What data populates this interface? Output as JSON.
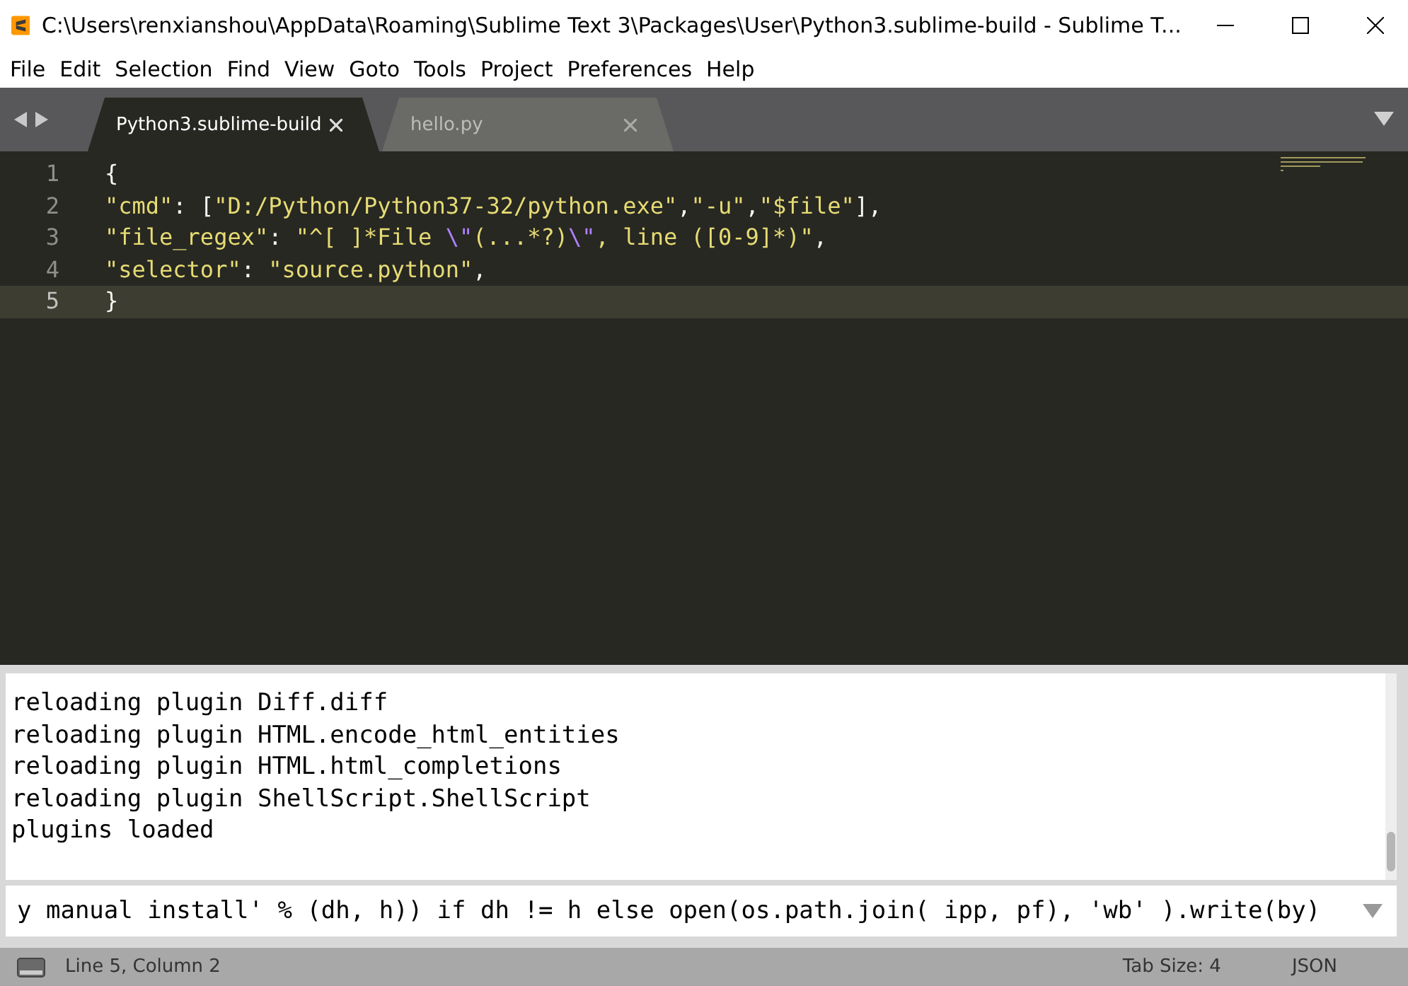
{
  "window": {
    "title": "C:\\Users\\renxianshou\\AppData\\Roaming\\Sublime Text 3\\Packages\\User\\Python3.sublime-build - Sublime T..."
  },
  "menu": [
    "File",
    "Edit",
    "Selection",
    "Find",
    "View",
    "Goto",
    "Tools",
    "Project",
    "Preferences",
    "Help"
  ],
  "tabs": [
    {
      "label": "Python3.sublime-build",
      "selected": true
    },
    {
      "label": "hello.py",
      "selected": false
    }
  ],
  "editor": {
    "lines": [
      {
        "number": "1",
        "current": false,
        "tokens": [
          {
            "kind": "plain",
            "text": "{"
          }
        ]
      },
      {
        "number": "2",
        "current": false,
        "tokens": [
          {
            "kind": "string",
            "text": "\"cmd\""
          },
          {
            "kind": "plain",
            "text": ": ["
          },
          {
            "kind": "string",
            "text": "\"D:/Python/Python37-32/python.exe\""
          },
          {
            "kind": "plain",
            "text": ","
          },
          {
            "kind": "string",
            "text": "\"-u\""
          },
          {
            "kind": "plain",
            "text": ","
          },
          {
            "kind": "string",
            "text": "\"$file\""
          },
          {
            "kind": "plain",
            "text": "],"
          }
        ]
      },
      {
        "number": "3",
        "current": false,
        "tokens": [
          {
            "kind": "string",
            "text": "\"file_regex\""
          },
          {
            "kind": "plain",
            "text": ": "
          },
          {
            "kind": "string",
            "text": "\"^[ ]*File "
          },
          {
            "kind": "escape",
            "text": "\\\""
          },
          {
            "kind": "string",
            "text": "(...*?)"
          },
          {
            "kind": "escape",
            "text": "\\\""
          },
          {
            "kind": "string",
            "text": ", line ([0-9]*)\""
          },
          {
            "kind": "plain",
            "text": ","
          }
        ]
      },
      {
        "number": "4",
        "current": false,
        "tokens": [
          {
            "kind": "string",
            "text": "\"selector\""
          },
          {
            "kind": "plain",
            "text": ": "
          },
          {
            "kind": "string",
            "text": "\"source.python\""
          },
          {
            "kind": "plain",
            "text": ","
          }
        ]
      },
      {
        "number": "5",
        "current": true,
        "tokens": [
          {
            "kind": "plain",
            "text": "}"
          }
        ]
      }
    ]
  },
  "console": {
    "lines": [
      "reloading plugin Diff.diff",
      "reloading plugin HTML.encode_html_entities",
      "reloading plugin HTML.html_completions",
      "reloading plugin ShellScript.ShellScript",
      "plugins loaded"
    ],
    "input": "y manual install' % (dh, h)) if dh != h else open(os.path.join( ipp, pf), 'wb' ).write(by)"
  },
  "status_bar": {
    "position": "Line 5, Column 2",
    "tab_size": "Tab Size: 4",
    "syntax": "JSON"
  }
}
